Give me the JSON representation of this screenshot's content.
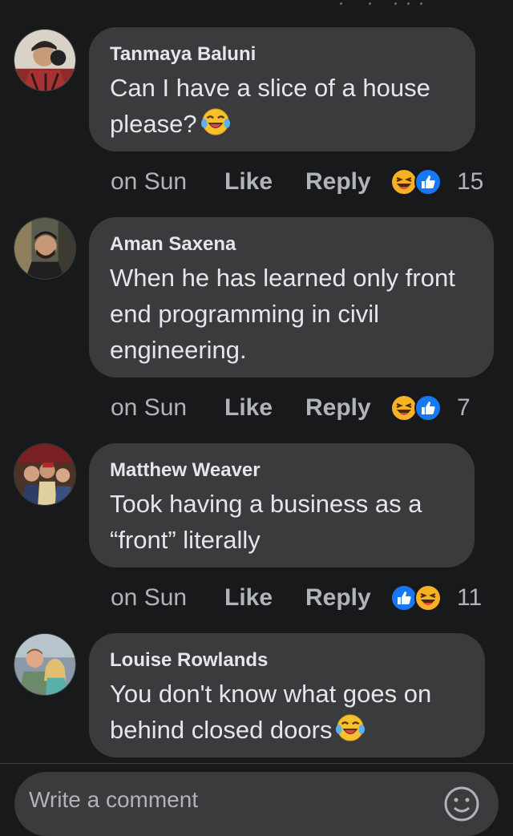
{
  "comments": [
    {
      "name": "Tanmaya Baluni",
      "text": "Can I have a slice of a house please?",
      "time": "on Sun",
      "like": "Like",
      "reply": "Reply",
      "reaction_count": "15",
      "text_emoji": "laughing-tears-icon",
      "reactions": [
        "haha-icon",
        "like-icon"
      ]
    },
    {
      "name": "Aman Saxena",
      "text": "When he has learned only front end programming in civil engineering.",
      "time": "on Sun",
      "like": "Like",
      "reply": "Reply",
      "reaction_count": "7",
      "reactions": [
        "haha-icon",
        "like-icon"
      ]
    },
    {
      "name": "Matthew Weaver",
      "text": "Took having a business as a “front” literally",
      "time": "on Sun",
      "like": "Like",
      "reply": "Reply",
      "reaction_count": "11",
      "reactions": [
        "like-icon",
        "haha-icon"
      ]
    },
    {
      "name": "Louise Rowlands",
      "text": "You don't know what goes on behind closed doors",
      "text_emoji": "laughing-tears-icon"
    }
  ],
  "composer": {
    "placeholder": "Write a comment"
  },
  "colors": {
    "background": "#18191a",
    "bubble": "#3a3b3c",
    "text": "#e4e6eb",
    "secondary": "#b0b3b8",
    "like_blue": "#1877f2",
    "haha_yellow": "#f7b125"
  }
}
